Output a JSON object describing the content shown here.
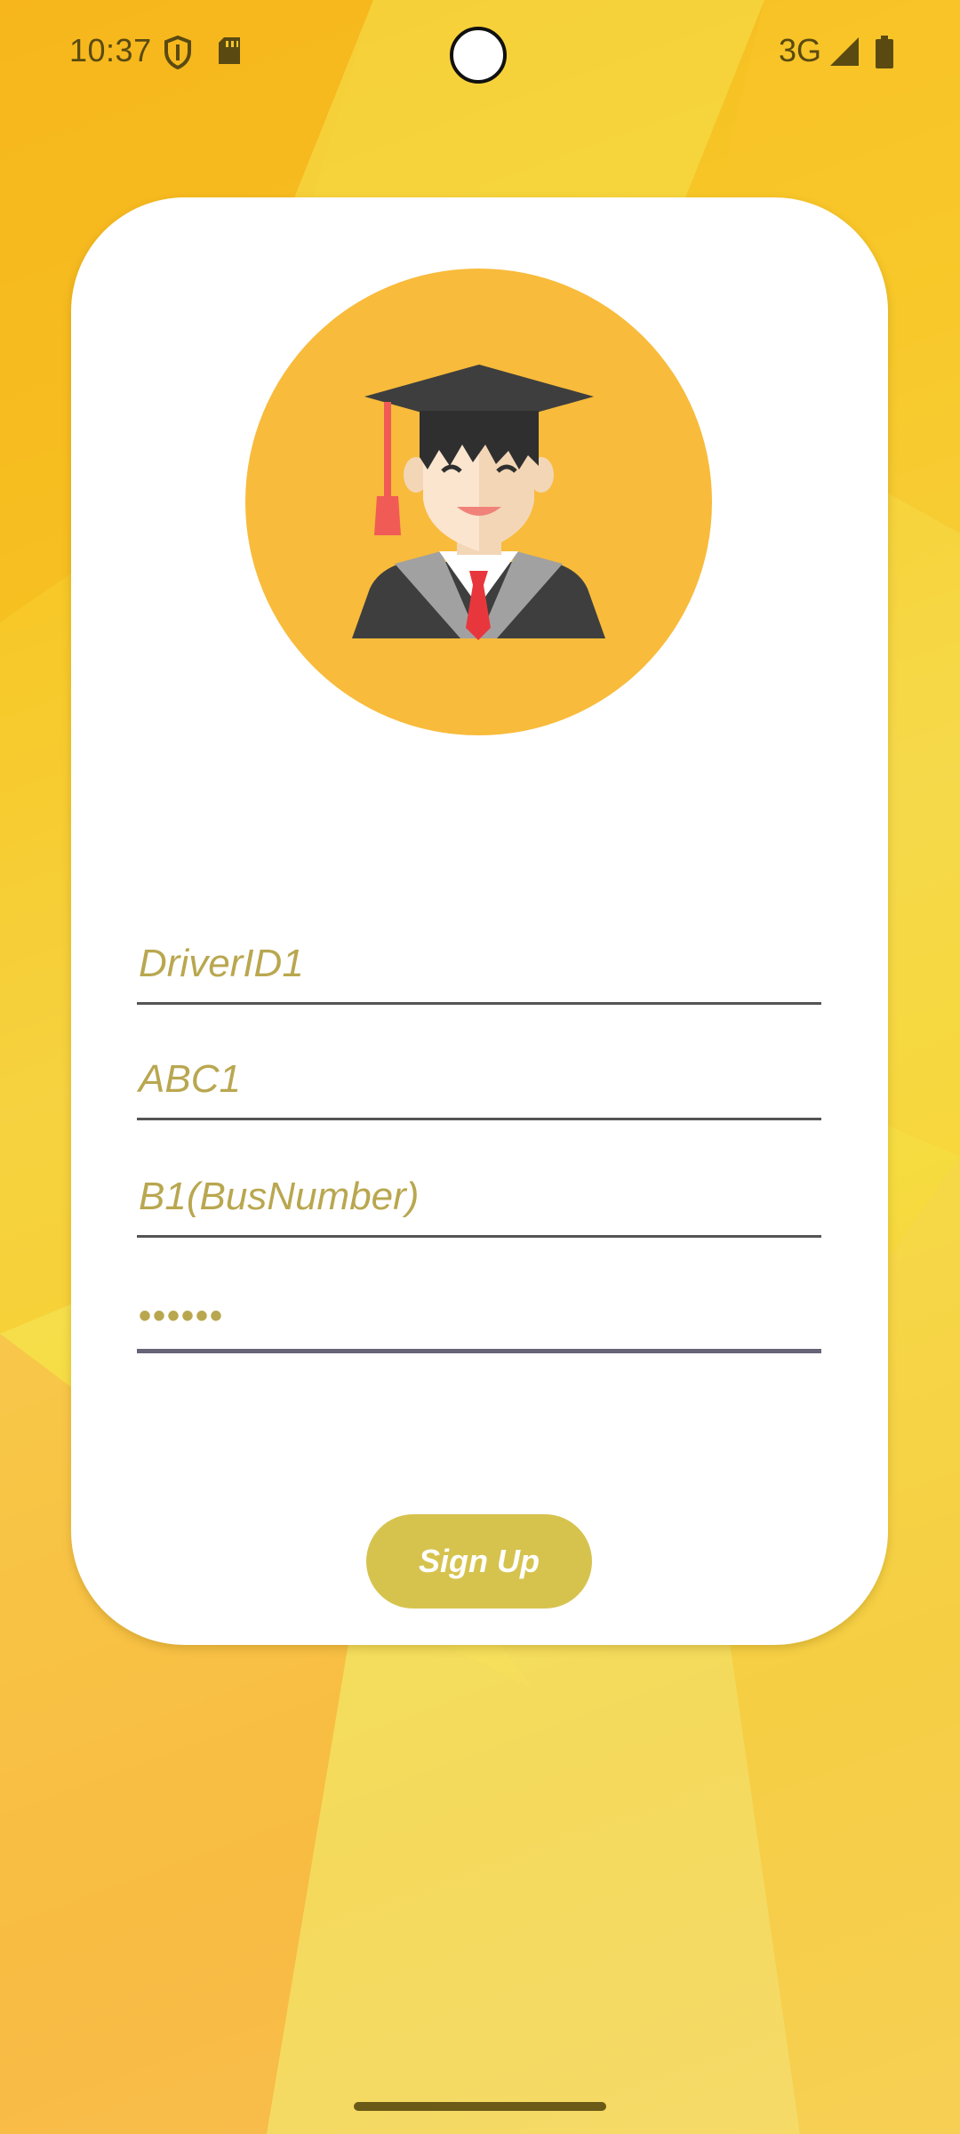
{
  "status_bar": {
    "time": "10:37",
    "network": "3G",
    "icons": [
      "shield-icon",
      "sd-card-icon",
      "signal-icon",
      "battery-icon"
    ]
  },
  "form": {
    "driver_id": "DriverID1",
    "name": "ABC1",
    "bus_number": "B1(BusNumber)",
    "password": "••••••"
  },
  "signup_button": {
    "label": "Sign Up"
  },
  "colors": {
    "background": "#f7cc2a",
    "avatar_bg": "#f8bb3b",
    "field_text": "#b9a750",
    "button_bg": "#d6c34e"
  }
}
